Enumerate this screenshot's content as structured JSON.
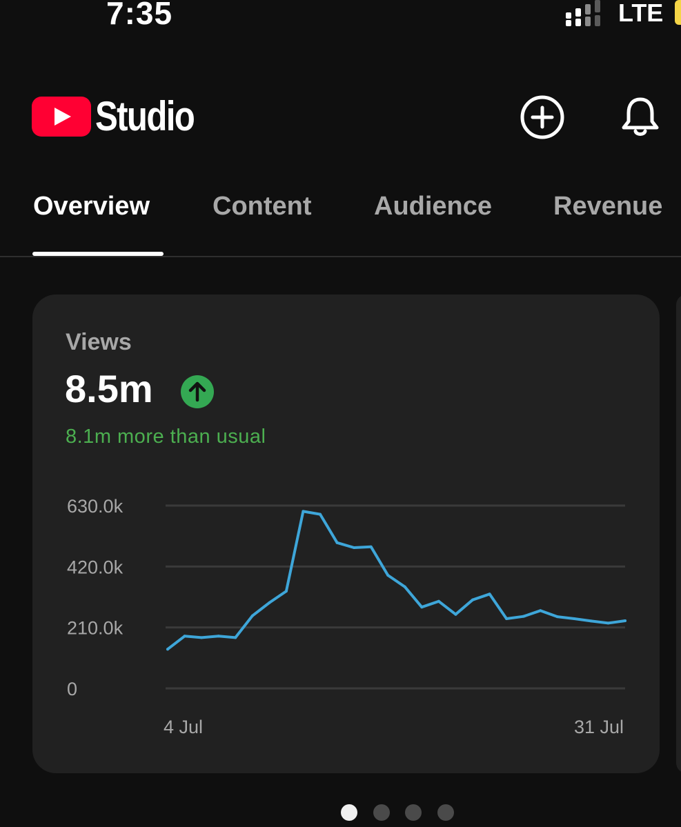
{
  "status_bar": {
    "time": "7:35",
    "network": "LTE",
    "signal_icon": "signal-bars-icon",
    "battery_color": "#f5d547"
  },
  "header": {
    "app_name": "Studio",
    "logo_icon": "youtube-play-icon",
    "logo_color": "#ff0033",
    "actions": [
      {
        "name": "create-button",
        "icon": "plus-circle-icon"
      },
      {
        "name": "notifications-button",
        "icon": "bell-icon"
      }
    ]
  },
  "tabs": [
    {
      "label": "Overview",
      "active": true
    },
    {
      "label": "Content",
      "active": false
    },
    {
      "label": "Audience",
      "active": false
    },
    {
      "label": "Revenue",
      "active": false
    }
  ],
  "card": {
    "metric_label": "Views",
    "metric_value": "8.5m",
    "trend_icon": "arrow-up-icon",
    "trend_color": "#34a853",
    "note": "8.1m more than usual",
    "note_color": "#4caf50"
  },
  "chart_data": {
    "type": "line",
    "series_color": "#3ea6d9",
    "y_ticks": [
      {
        "label": "630.0k",
        "value": 630000
      },
      {
        "label": "420.0k",
        "value": 420000
      },
      {
        "label": "210.0k",
        "value": 210000
      },
      {
        "label": "0",
        "value": 0
      }
    ],
    "x_tick_labels": [
      "4 Jul",
      "31 Jul"
    ],
    "ylim": [
      0,
      630000
    ],
    "grid": true,
    "x": [
      1,
      2,
      3,
      4,
      5,
      6,
      7,
      8,
      9,
      10,
      11,
      12,
      13,
      14,
      15,
      16,
      17,
      18,
      19,
      20,
      21,
      22,
      23,
      24,
      25,
      26,
      27,
      28
    ],
    "values": [
      135000,
      180000,
      175000,
      180000,
      175000,
      250000,
      295000,
      335000,
      610000,
      600000,
      502000,
      485000,
      488000,
      390000,
      350000,
      280000,
      300000,
      255000,
      305000,
      325000,
      240000,
      248000,
      268000,
      247000,
      240000,
      232000,
      225000,
      233000
    ]
  },
  "pagination": {
    "count": 4,
    "active_index": 0
  }
}
